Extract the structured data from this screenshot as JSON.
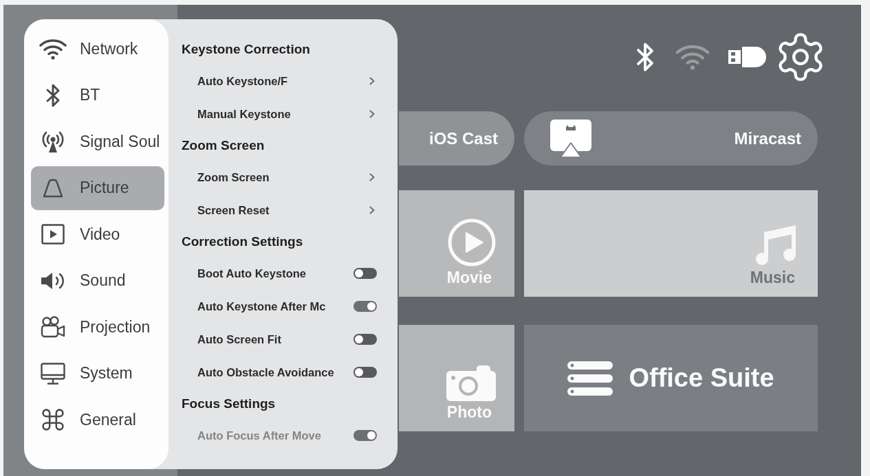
{
  "settings_menu": {
    "sidebar": [
      {
        "label": "Network",
        "selected": false
      },
      {
        "label": "BT",
        "selected": false
      },
      {
        "label": "Signal Soul",
        "selected": false
      },
      {
        "label": "Picture",
        "selected": true
      },
      {
        "label": "Video",
        "selected": false
      },
      {
        "label": "Sound",
        "selected": false
      },
      {
        "label": "Projection",
        "selected": false
      },
      {
        "label": "System",
        "selected": false
      },
      {
        "label": "General",
        "selected": false
      }
    ],
    "submenu": [
      {
        "heading": "Keystone Correction",
        "items": [
          {
            "kind": "link",
            "label": "Auto Keystone/F",
            "disabled": false
          },
          {
            "kind": "link",
            "label": "Manual Keystone",
            "disabled": false
          }
        ]
      },
      {
        "heading": "Zoom Screen",
        "items": [
          {
            "kind": "link",
            "label": "Zoom Screen",
            "disabled": false
          },
          {
            "kind": "link",
            "label": "Screen Reset",
            "disabled": false
          }
        ]
      },
      {
        "heading": "Correction Settings",
        "items": [
          {
            "kind": "toggle",
            "label": "Boot Auto Keystone",
            "on": false,
            "disabled": false
          },
          {
            "kind": "toggle",
            "label": "Auto Keystone After Mc",
            "on": true,
            "disabled": false
          },
          {
            "kind": "toggle",
            "label": "Auto Screen Fit",
            "on": false,
            "disabled": false
          },
          {
            "kind": "toggle",
            "label": "Auto Obstacle Avoidance",
            "on": false,
            "disabled": false
          }
        ]
      },
      {
        "heading": "Focus Settings",
        "items": [
          {
            "kind": "toggle",
            "label": "Auto Focus After Move",
            "on": true,
            "disabled": true
          }
        ]
      }
    ]
  },
  "home": {
    "cast_buttons": [
      {
        "label": "iOS Cast"
      },
      {
        "label": "Miracast"
      }
    ],
    "tiles": [
      {
        "kind": "stacked",
        "label": "Movie"
      },
      {
        "kind": "stacked",
        "label": "Music"
      },
      {
        "kind": "stacked",
        "label": "Photo"
      },
      {
        "kind": "wide",
        "label": "Office Suite"
      }
    ]
  }
}
